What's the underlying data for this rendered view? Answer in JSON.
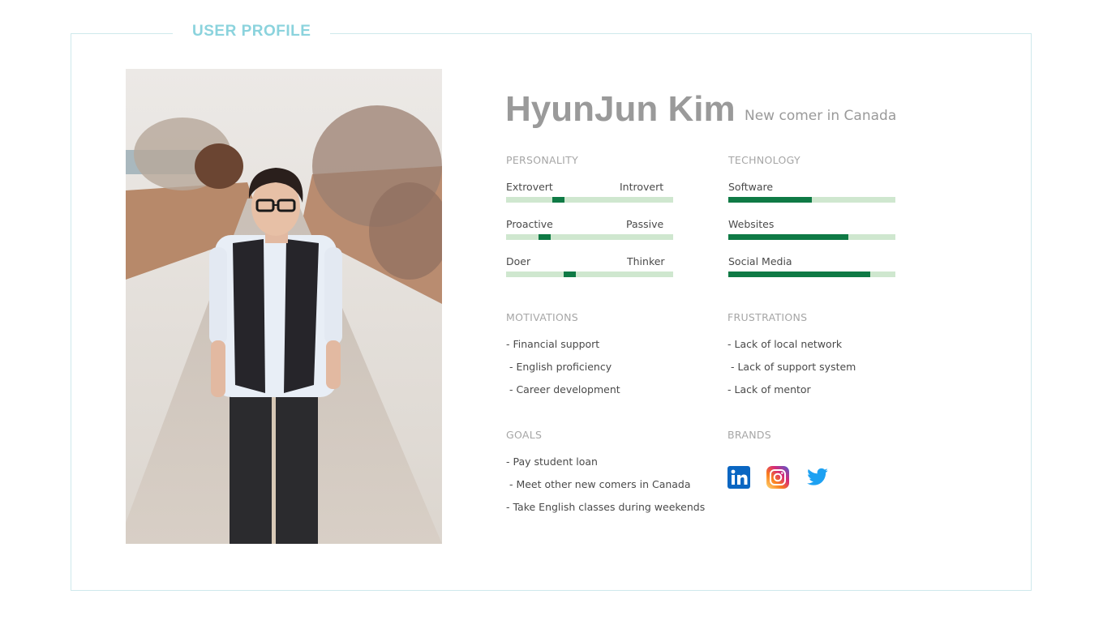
{
  "header": {
    "title": "USER PROFILE"
  },
  "profile": {
    "name": "HyunJun Kim",
    "subtitle": "New comer in Canada"
  },
  "personality": {
    "heading": "PERSONALITY",
    "scales": [
      {
        "left": "Extrovert",
        "right": "Introvert",
        "value": 0.31
      },
      {
        "left": "Proactive",
        "right": "Passive",
        "value": 0.23
      },
      {
        "left": "Doer",
        "right": "Thinker",
        "value": 0.38
      }
    ]
  },
  "technology": {
    "heading": "TECHNOLOGY",
    "items": [
      {
        "label": "Software",
        "value": 0.5
      },
      {
        "label": "Websites",
        "value": 0.72
      },
      {
        "label": "Social Media",
        "value": 0.85
      }
    ]
  },
  "motivations": {
    "heading": "MOTIVATIONS",
    "items": [
      "- Financial support",
      " - English proficiency",
      " - Career development"
    ]
  },
  "frustrations": {
    "heading": "FRUSTRATIONS",
    "items": [
      "- Lack of local network",
      " - Lack of support system",
      "- Lack of mentor"
    ]
  },
  "goals": {
    "heading": "GOALS",
    "items": [
      "- Pay student loan",
      " - Meet other new comers in Canada",
      "- Take English classes during weekends"
    ]
  },
  "brands": {
    "heading": "BRANDS",
    "icons": [
      "linkedin-icon",
      "instagram-icon",
      "twitter-icon"
    ]
  },
  "colors": {
    "accent": "#8bd3dd",
    "bar_fill": "#0f7a45",
    "bar_track": "#cfe7cf",
    "linkedin": "#0a66c2",
    "twitter": "#1da1f2"
  }
}
